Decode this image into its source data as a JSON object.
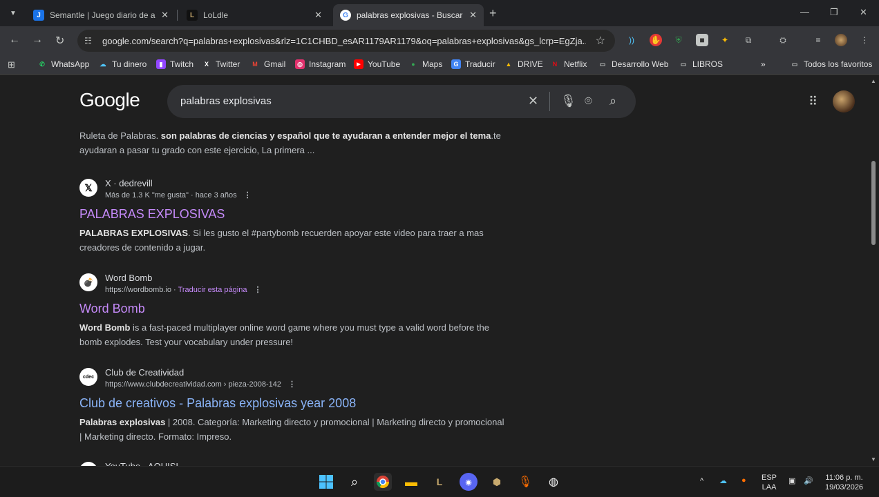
{
  "browser": {
    "tabs": [
      {
        "title": "Semantle | Juego diario de adiv",
        "favicon_text": "J",
        "favicon_color": "#1a73e8",
        "active": false
      },
      {
        "title": "LoLdle",
        "favicon_text": "L",
        "favicon_color": "#c8aa6e",
        "active": false
      },
      {
        "title": "palabras explosivas - Buscar cor",
        "favicon_text": "G",
        "favicon_color": "#ffffff",
        "active": true
      }
    ],
    "url": "google.com/search?q=palabras+explosivas&rlz=1C1CHBD_esAR1179AR1179&oq=palabras+explosivas&gs_lcrp=EgZja...",
    "bookmarks": [
      {
        "label": "WhatsApp",
        "icon": "whatsapp-icon",
        "color": "#25d366",
        "glyph": "✆"
      },
      {
        "label": "Tu dinero",
        "icon": "cloud-icon",
        "color": "#4fc3f7",
        "glyph": "☁"
      },
      {
        "label": "Twitch",
        "icon": "twitch-icon",
        "color": "#9146ff",
        "glyph": "▮"
      },
      {
        "label": "Twitter",
        "icon": "x-icon",
        "color": "#ffffff",
        "glyph": "X"
      },
      {
        "label": "Gmail",
        "icon": "gmail-icon",
        "color": "#ea4335",
        "glyph": "M"
      },
      {
        "label": "Instagram",
        "icon": "instagram-icon",
        "color": "#e1306c",
        "glyph": "◎"
      },
      {
        "label": "YouTube",
        "icon": "youtube-icon",
        "color": "#ff0000",
        "glyph": "▶"
      },
      {
        "label": "Maps",
        "icon": "maps-icon",
        "color": "#34a853",
        "glyph": "●"
      },
      {
        "label": "Traducir",
        "icon": "translate-icon",
        "color": "#4285f4",
        "glyph": "G"
      },
      {
        "label": "DRIVE",
        "icon": "drive-icon",
        "color": "#fbbc04",
        "glyph": "▲"
      },
      {
        "label": "Netflix",
        "icon": "netflix-icon",
        "color": "#e50914",
        "glyph": "N"
      },
      {
        "label": "Desarrollo Web",
        "icon": "folder-icon",
        "color": "#c4c7c5",
        "glyph": "▭"
      },
      {
        "label": "LIBROS",
        "icon": "folder-icon",
        "color": "#c4c7c5",
        "glyph": "▭"
      }
    ],
    "bookmarks_overflow": "»",
    "all_bookmarks": "Todos los favoritos"
  },
  "google": {
    "logo": "Google",
    "query": "palabras explosivas"
  },
  "results": {
    "top_snippet": {
      "prefix": "Ruleta de Palabras. ",
      "bold": "son palabras de ciencias y español que te ayudaran a entender mejor el tema",
      "suffix": ".te ayudaran a pasar tu grado con este ejercicio, La primera ..."
    },
    "items": [
      {
        "site": "X · dedrevill",
        "url": "Más de 1.3 K \"me gusta\" · hace 3 años",
        "translate": "",
        "title": "PALABRAS EXPLOSIVAS",
        "visited": true,
        "snippet_bold": "PALABRAS EXPLOSIVAS",
        "snippet": ". Si les gusto el #partybomb recuerden apoyar este video para traer a mas creadores de contenido a jugar.",
        "icon": "X"
      },
      {
        "site": "Word Bomb",
        "url": "https://wordbomb.io",
        "translate": "Traducir esta página",
        "title": "Word Bomb",
        "visited": true,
        "snippet_bold": "Word Bomb",
        "snippet": " is a fast-paced multiplayer online word game where you must type a valid word before the bomb explodes. Test your vocabulary under pressure!",
        "icon": "💣"
      },
      {
        "site": "Club de Creatividad",
        "url": "https://www.clubdecreatividad.com › pieza-2008-142",
        "translate": "",
        "title": "Club de creativos - Palabras explosivas year 2008",
        "visited": false,
        "snippet_bold": "Palabras explosivas",
        "snippet": " | 2008. Categoría: Marketing directo y promocional | Marketing directo y promocional | Marketing directo. Formato: Impreso.",
        "icon": "cdec"
      }
    ],
    "partial_next": "YouTube · AQUISI"
  },
  "taskbar": {
    "lang": "ESP",
    "lang2": "LAA",
    "time": "11:06 p. m.",
    "date": "19/03/2026"
  }
}
